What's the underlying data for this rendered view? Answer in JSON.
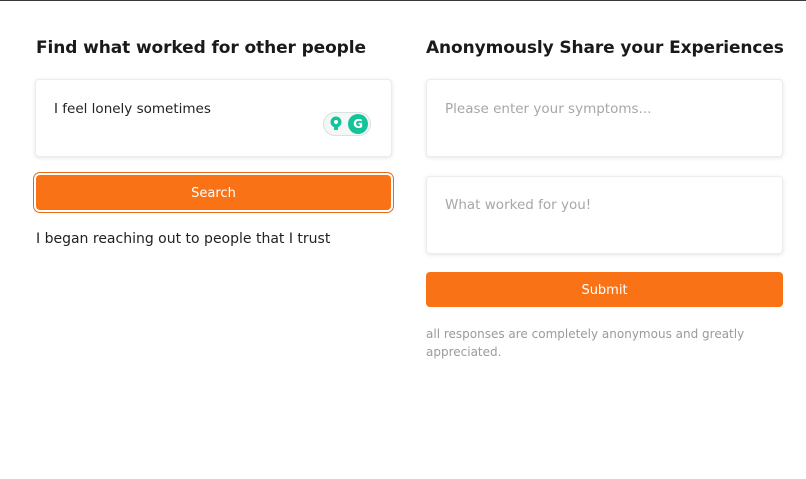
{
  "search_section": {
    "title": "Find what worked for other people",
    "query_value": "I feel lonely sometimes",
    "search_button_label": "Search",
    "result_text": "I began reaching out to people that I trust",
    "extension_logo_letter": "G"
  },
  "share_section": {
    "title": "Anonymously Share your Experiences",
    "symptoms_placeholder": "Please enter your symptoms...",
    "worked_placeholder": "What worked for you!",
    "submit_button_label": "Submit",
    "note": "all responses are completely anonymous and greatly appreciated."
  },
  "colors": {
    "accent": "#f97316",
    "grammarly_green": "#15c39a"
  },
  "icons": {
    "bulb": "grammarly-bulb-icon",
    "logo": "grammarly-logo-icon"
  }
}
